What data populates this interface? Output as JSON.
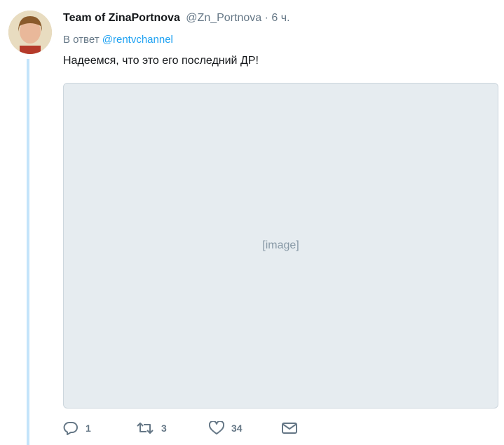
{
  "tweet": {
    "author_name": "Team of ZinaPortnova",
    "author_handle": "@Zn_Portnova",
    "separator": "·",
    "time": "6 ч.",
    "reply_prefix": "В ответ",
    "reply_handle": "@rentvchannel",
    "text": "Надеемся, что это его последний ДР!",
    "media_placeholder": "[image]"
  },
  "actions": {
    "reply_count": "1",
    "retweet_count": "3",
    "like_count": "34"
  },
  "icons": [
    "reply-icon",
    "retweet-icon",
    "like-icon",
    "direct-message-icon"
  ],
  "colors": {
    "link": "#1da1f2",
    "secondary": "#657786",
    "thread_line": "#c4e4fa"
  }
}
